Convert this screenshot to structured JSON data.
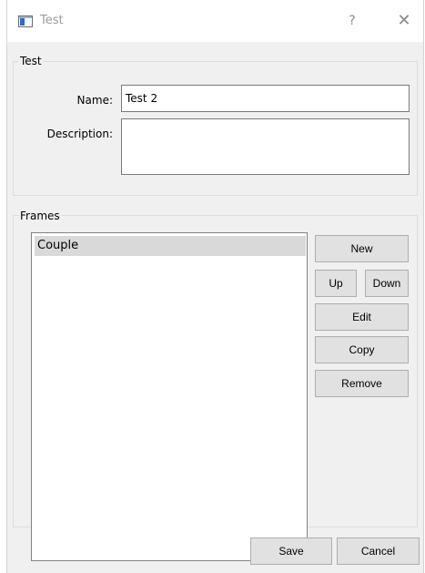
{
  "window": {
    "title": "Test",
    "help_label": "?",
    "close_label": "✕"
  },
  "test_group": {
    "title": "Test",
    "name_label": "Name:",
    "name_value": "Test 2",
    "description_label": "Description:",
    "description_value": ""
  },
  "frames_group": {
    "title": "Frames",
    "items": [
      {
        "label": "Couple",
        "selected": true
      }
    ],
    "buttons": {
      "new": "New",
      "up": "Up",
      "down": "Down",
      "edit": "Edit",
      "copy": "Copy",
      "remove": "Remove"
    }
  },
  "footer": {
    "save": "Save",
    "cancel": "Cancel"
  }
}
